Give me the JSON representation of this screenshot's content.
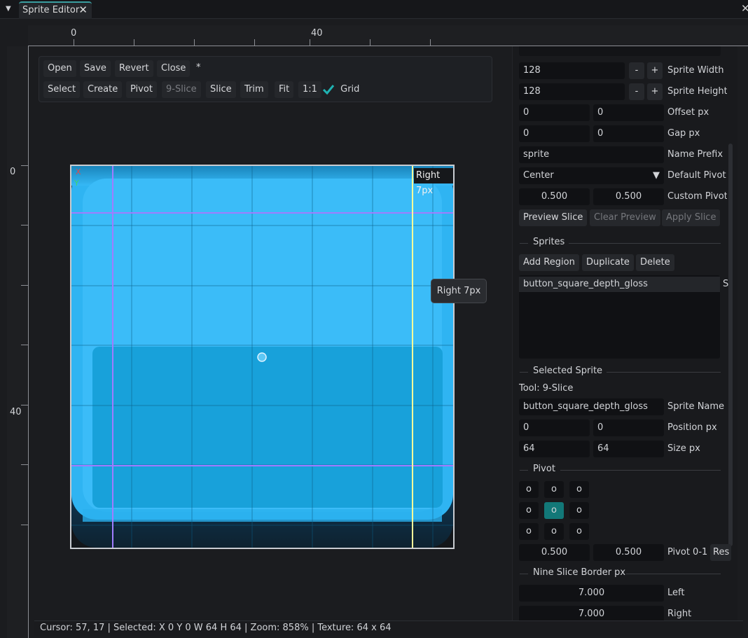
{
  "tab": {
    "title": "Sprite Editor",
    "close_glyph": "✕"
  },
  "window": {
    "close_glyph": "✕",
    "menu_glyph": "▼"
  },
  "ruler": {
    "top_labels": [
      "0",
      "40"
    ],
    "left_labels": [
      "0",
      "40"
    ]
  },
  "toolbar": {
    "row1": [
      "Open",
      "Save",
      "Revert",
      "Close"
    ],
    "modified_marker": "*",
    "row2": [
      "Select",
      "Create",
      "Pivot",
      "9-Slice",
      "Slice",
      "Trim",
      "Fit",
      "1:1"
    ],
    "grid_label": "Grid",
    "grid_checked": true
  },
  "canvas": {
    "axis_x": "X",
    "axis_y": "Y",
    "guide_label": "Right 7px",
    "tooltip": "Right 7px",
    "colors": {
      "sprite": "#3bbcf8",
      "sprite_dark": "#16a0d8",
      "slice_guide": "#a07cff",
      "active_guide": "#ffff99"
    }
  },
  "slice_settings": {
    "sprite_width": "128",
    "sprite_width_label": "Sprite Width p",
    "sprite_height": "128",
    "sprite_height_label": "Sprite Height p",
    "minus": "-",
    "plus": "+",
    "offset_x": "0",
    "offset_y": "0",
    "offset_label": "Offset px",
    "gap_x": "0",
    "gap_y": "0",
    "gap_label": "Gap px",
    "name_prefix": "sprite",
    "name_prefix_label": "Name Prefix",
    "default_pivot": "Center",
    "default_pivot_label": "Default Pivot",
    "custom_pivot_x": "0.500",
    "custom_pivot_y": "0.500",
    "custom_pivot_label": "Custom Pivot (",
    "preview_slice": "Preview Slice",
    "clear_preview": "Clear Preview",
    "apply_slice": "Apply Slice"
  },
  "sprites": {
    "title": "Sprites",
    "add_region": "Add Region",
    "duplicate": "Duplicate",
    "delete": "Delete",
    "items": [
      "button_square_depth_gloss"
    ],
    "side_hint": "S"
  },
  "selected": {
    "title": "Selected Sprite",
    "tool": "Tool: 9-Slice",
    "sprite_name": "button_square_depth_gloss",
    "sprite_name_label": "Sprite Name",
    "pos_x": "0",
    "pos_y": "0",
    "position_label": "Position px",
    "size_w": "64",
    "size_h": "64",
    "size_label": "Size px"
  },
  "pivot": {
    "title": "Pivot",
    "grid": [
      "o",
      "o",
      "o",
      "o",
      "o",
      "o",
      "o",
      "o",
      "o"
    ],
    "x": "0.500",
    "y": "0.500",
    "label": "Pivot 0-1",
    "reset": "Res"
  },
  "nine_slice": {
    "title": "Nine Slice Border px",
    "left": "7.000",
    "left_label": "Left",
    "right": "7.000",
    "right_label": "Right"
  },
  "status": {
    "text": "Cursor: 57, 17 | Selected: X 0  Y 0  W 64  H 64 | Zoom: 858% | Texture: 64 x 64"
  }
}
